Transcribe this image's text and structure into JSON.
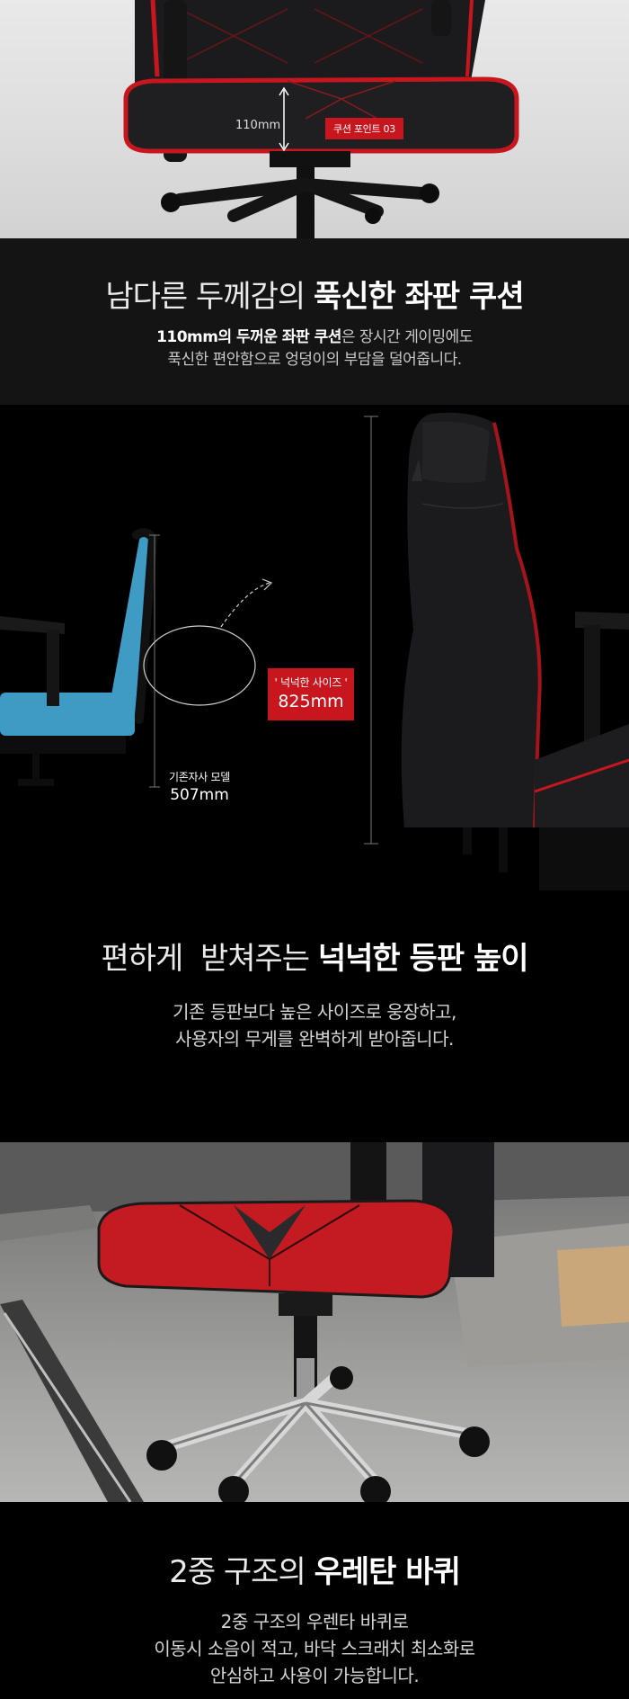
{
  "seat_section": {
    "dimension_label": "110mm",
    "point_badge": "쿠션 포인트 03",
    "headline_light": "남다른 두께감의",
    "headline_bold": "푹신한 좌판 쿠션",
    "desc_bold_1": "110mm의 두꺼운 좌판 쿠션",
    "desc_rest_1": "은 장시간 게이밍에도",
    "desc_line_2": "푹신한 편안함으로 엉덩이의 부담을 덜어줍니다."
  },
  "back_section": {
    "size_badge_label": "' 넉넉한 사이즈 '",
    "size_badge_value": "825mm",
    "model_label": "기존자사 모델",
    "model_value": "507mm",
    "headline_light": "편하게  받쳐주는",
    "headline_bold": "넉넉한 등판 높이",
    "desc_line_1": "기존 등판보다 높은 사이즈로 웅장하고,",
    "desc_line_2": "사용자의 무게를 완벽하게 받아줍니다."
  },
  "wheel_section": {
    "headline_light": "2중 구조의",
    "headline_bold": "우레탄 바퀴",
    "desc_line_1": "2중 구조의 우렌타 바퀴로",
    "desc_line_2": "이동시 소음이 적고, 바닥 스크래치 최소화로",
    "desc_line_3": "안심하고 사용이 가능합니다."
  },
  "colors": {
    "accent_red": "#c8161e",
    "teal_chair": "#3e9bc4",
    "dark_band": "#141414"
  }
}
